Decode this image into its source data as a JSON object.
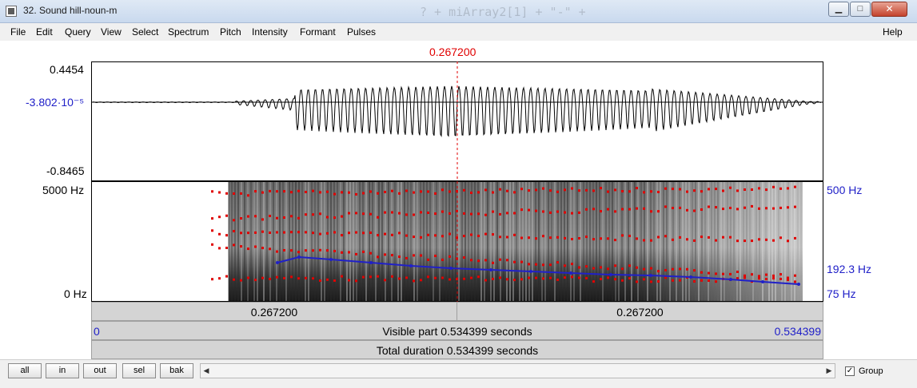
{
  "window": {
    "title": "32. Sound hill-noun-m",
    "background_text": "? + miArray2[1] + \"-\" +",
    "min_symbol": "▁",
    "max_symbol": "□",
    "close_symbol": "✕"
  },
  "menu": {
    "items": [
      "File",
      "Edit",
      "Query",
      "View",
      "Select",
      "Spectrum",
      "Pitch",
      "Intensity",
      "Formant",
      "Pulses"
    ],
    "help": "Help"
  },
  "editor": {
    "cursor_time": "0.267200",
    "waveform": {
      "max_label": "0.4454",
      "zero_label": "-3.802·10⁻⁵",
      "min_label": "-0.8465"
    },
    "spectrogram": {
      "freq_top": "5000 Hz",
      "freq_bottom": "0 Hz"
    },
    "pitch": {
      "top": "500 Hz",
      "current": "192.3 Hz",
      "bottom": "75 Hz"
    },
    "bars": {
      "left_segment": "0.267200",
      "right_segment": "0.267200",
      "start": "0",
      "visible": "Visible part 0.534399 seconds",
      "end": "0.534399",
      "total": "Total duration 0.534399 seconds"
    }
  },
  "toolbar": {
    "all": "all",
    "in": "in",
    "out": "out",
    "sel": "sel",
    "bak": "bak",
    "group_label": "Group",
    "group_checked": "✓"
  },
  "colors": {
    "cursor": "#e00000",
    "pitch": "#2020c8",
    "formant": "#e00000"
  }
}
